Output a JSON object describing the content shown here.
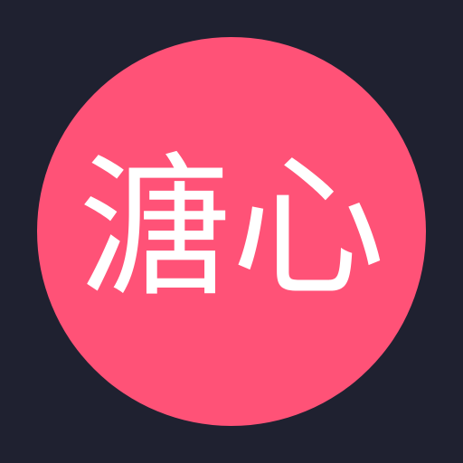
{
  "avatar": {
    "text": "溏心",
    "background_color": "#ff5277",
    "text_color": "#ffffff"
  },
  "page": {
    "background_color": "#1f2130"
  }
}
